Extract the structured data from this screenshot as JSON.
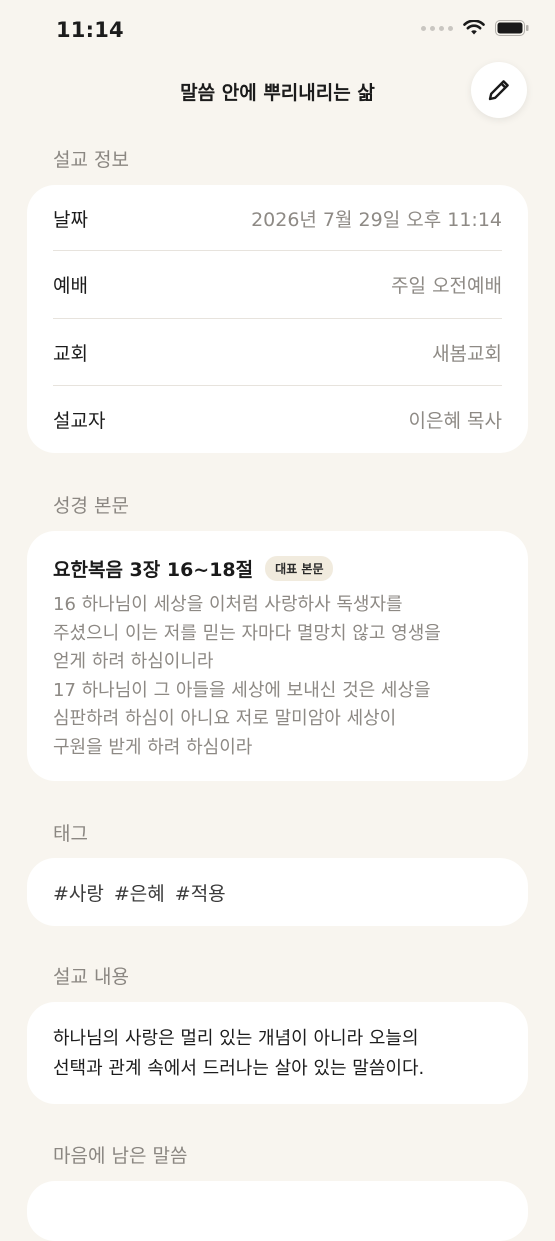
{
  "status_bar": {
    "time": "11:14",
    "icons": [
      "signal-dots-icon",
      "wifi-icon",
      "battery-icon"
    ]
  },
  "nav": {
    "title": "말씀 안에 뿌리내리는 삶",
    "edit_icon": "pencil-icon"
  },
  "sermon_info": {
    "label": "설교 정보",
    "rows": [
      {
        "label": "날짜",
        "value": "2026년 7월 29일 오후 11:14"
      },
      {
        "label": "예배",
        "value": "주일 오전예배"
      },
      {
        "label": "교회",
        "value": "새봄교회"
      },
      {
        "label": "설교자",
        "value": "이은혜 목사"
      }
    ]
  },
  "scripture": {
    "label": "성경 본문",
    "reference": "요한복음 3장 16~18절",
    "badge": "대표 본문",
    "text": "16 하나님이 세상을 이처럼 사랑하사 독생자를\n주셨으니 이는 저를 믿는 자마다 멸망치 않고 영생을\n얻게 하려 하심이니라\n17 하나님이 그 아들을 세상에 보내신 것은 세상을\n심판하려 하심이 아니요 저로 말미암아 세상이\n구원을 받게 하려 하심이라"
  },
  "tags": {
    "label": "태그",
    "items": [
      "#사랑",
      "#은혜",
      "#적용"
    ]
  },
  "sermon_content": {
    "label": "설교 내용",
    "text": "하나님의 사랑은 멀리 있는 개념이 아니라 오늘의\n선택과 관계 속에서 드러나는 살아 있는 말씀이다."
  },
  "memorable": {
    "label": "마음에 남은 말씀"
  },
  "colors": {
    "background": "#f8f5ef",
    "card": "#ffffff",
    "secondary_text": "#8e8a85",
    "badge_bg": "#f1ebde"
  }
}
